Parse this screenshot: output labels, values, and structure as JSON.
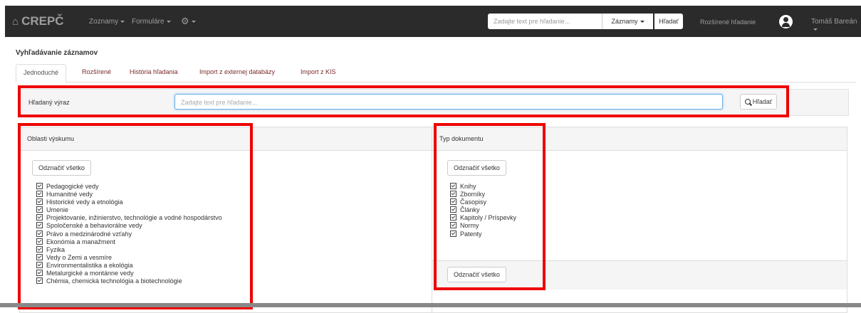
{
  "navbar": {
    "brand": "CREPČ",
    "menu": [
      "Zoznamy",
      "Formuláre"
    ],
    "search_placeholder": "Zadajte text pre hľadanie...",
    "search_scope": "Záznamy",
    "search_button": "Hľadať",
    "advanced_search": "Rozšírené hľadanie",
    "user_name": "Tomáš Bareán"
  },
  "page": {
    "title": "Vyhľadávanie záznamov",
    "tabs": [
      "Jednoduché",
      "Rozšírené",
      "História hľadania",
      "Import z externej databázy",
      "Import z KIS"
    ]
  },
  "search": {
    "label": "Hľadaný výraz",
    "placeholder": "Zadajte text pre hľadanie...",
    "button": "Hľadať"
  },
  "areas": {
    "title": "Oblasti výskumu",
    "select_all": "Odznačiť všetko",
    "items": [
      "Pedagogické vedy",
      "Humanitné vedy",
      "Historické vedy a etnológia",
      "Umenie",
      "Projektovanie, inžinierstvo, technológie a vodné hospodárstvo",
      "Spoločenské a behaviorálne vedy",
      "Právo a medzinárodné vzťahy",
      "Ekonómia a manažment",
      "Fyzika",
      "Vedy o Zemi a vesmíre",
      "Environmentalistika a ekológia",
      "Metalurgické a montánne vedy",
      "Chémia, chemická technológia a biotechnológie"
    ]
  },
  "doctypes": {
    "title": "Typ dokumentu",
    "select_all": "Odznačiť všetko",
    "select_all_bottom": "Odznačiť všetko",
    "items": [
      "Knihy",
      "Zborníky",
      "Časopisy",
      "Články",
      "Kapitoly / Príspevky",
      "Normy",
      "Patenty"
    ]
  },
  "colors": {
    "navbar_bg": "#2b2b2b",
    "highlight": "#e00000",
    "link": "#7a2a2a",
    "focus": "#66afe9"
  }
}
